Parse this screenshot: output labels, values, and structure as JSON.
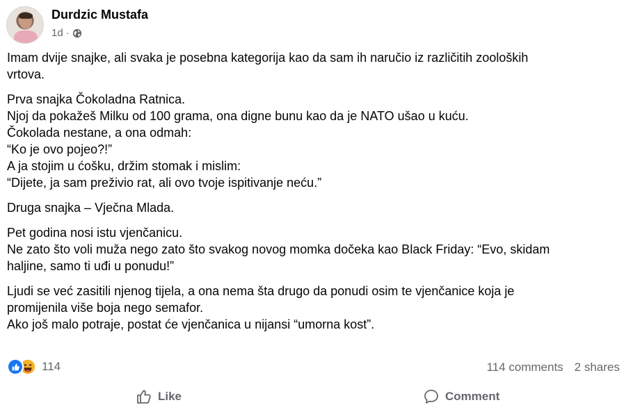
{
  "post": {
    "author": "Durdzic Mustafa",
    "time": "1d",
    "separator": "·",
    "paragraphs": [
      [
        "Imam dvije snajke, ali svaka je posebna kategorija  kao da sam ih naručio iz različitih zooloških",
        "vrtova."
      ],
      [
        "Prva snajka  Čokoladna Ratnica.",
        "Njoj da pokažeš Milku od 100 grama, ona digne bunu kao da je NATO ušao u kuću.",
        "Čokolada nestane, a ona odmah:",
        "“Ko je ovo pojeo?!”",
        "A ja stojim u ćošku, držim stomak i mislim:",
        "“Dijete, ja sam preživio rat, ali ovo tvoje ispitivanje neću.”"
      ],
      [
        "Druga snajka – Vječna Mlada."
      ],
      [
        "Pet godina nosi istu vjenčanicu.",
        "Ne zato što voli muža  nego zato što svakog novog momka dočeka kao Black Friday: “Evo, skidam",
        "haljine, samo ti uđi u ponudu!”"
      ],
      [
        "Ljudi se već zasitili njenog tijela, a ona nema šta drugo da ponudi osim te vjenčanice koja je",
        "promijenila više boja nego semafor.",
        "Ako još malo potraje, postat će vjenčanica u nijansi “umorna kost”."
      ]
    ]
  },
  "engagement": {
    "reaction_count": "114",
    "reaction_icons": [
      "like-icon",
      "haha-icon"
    ],
    "comments": "114 comments",
    "shares": "2 shares"
  },
  "actions": {
    "like_label": "Like",
    "comment_label": "Comment"
  },
  "colors": {
    "text": "#050505",
    "secondary": "#65676b",
    "like_blue": "#1877f2",
    "haha_yellow": "#f7b125"
  }
}
